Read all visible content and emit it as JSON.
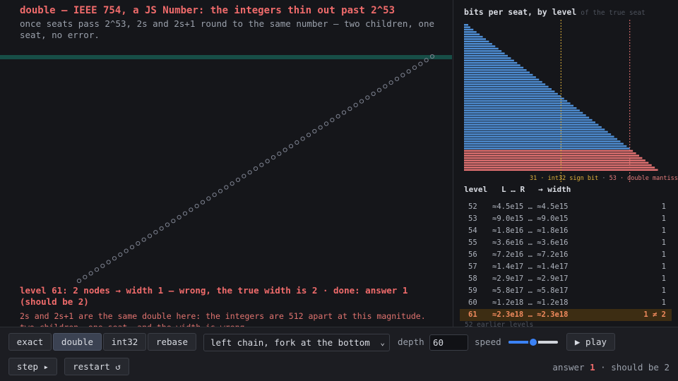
{
  "visualization": {
    "title": "double — IEEE 754, a JS Number: the integers thin out past 2^53",
    "subtitle": "once seats pass 2^53, 2s and 2s+1 round to the same number — two children, one seat, no error.",
    "status": "level 61: 2 nodes → width 1 — wrong, the true width is 2 · done: answer 1 (should be 2)",
    "explanation": "2s and 2s+1 are the same double here: the integers are 512 apart at this magnitude. two children, one seat, and the width is wrong."
  },
  "bits_panel": {
    "title": "bits per seat, by level",
    "subtitle": "of the true seat",
    "marker_int32": "31 · int32 sign bit",
    "marker_separator": " · ",
    "marker_double": "53 · double mantissa",
    "colors": {
      "exact": "#4f8fd6",
      "lossy": "#e57373",
      "int32_marker": "#e0b23c",
      "double_marker": "#e57373"
    }
  },
  "table": {
    "headers": {
      "level": "level",
      "range": "L … R",
      "width": "→ width"
    },
    "rows": [
      {
        "level": "52",
        "range": "≈4.5e15 … ≈4.5e15",
        "width": "1",
        "highlight": false
      },
      {
        "level": "53",
        "range": "≈9.0e15 … ≈9.0e15",
        "width": "1",
        "highlight": false
      },
      {
        "level": "54",
        "range": "≈1.8e16 … ≈1.8e16",
        "width": "1",
        "highlight": false
      },
      {
        "level": "55",
        "range": "≈3.6e16 … ≈3.6e16",
        "width": "1",
        "highlight": false
      },
      {
        "level": "56",
        "range": "≈7.2e16 … ≈7.2e16",
        "width": "1",
        "highlight": false
      },
      {
        "level": "57",
        "range": "≈1.4e17 … ≈1.4e17",
        "width": "1",
        "highlight": false
      },
      {
        "level": "58",
        "range": "≈2.9e17 … ≈2.9e17",
        "width": "1",
        "highlight": false
      },
      {
        "level": "59",
        "range": "≈5.8e17 … ≈5.8e17",
        "width": "1",
        "highlight": false
      },
      {
        "level": "60",
        "range": "≈1.2e18 … ≈1.2e18",
        "width": "1",
        "highlight": false
      },
      {
        "level": "61",
        "range": "≈2.3e18 … ≈2.3e18",
        "width": "1 ≠ 2",
        "highlight": true
      }
    ],
    "more": "52 earlier levels"
  },
  "controls": {
    "modes": [
      "exact",
      "double",
      "int32",
      "rebase"
    ],
    "active_mode": "double",
    "tree_shape": "left chain, fork at the bottom",
    "depth_label": "depth",
    "depth_value": "60",
    "speed_label": "speed",
    "speed_fraction": 0.5,
    "play_label": "▶ play",
    "step_label": "step ▸",
    "restart_label": "restart ↺",
    "answer_label": "answer",
    "answer_value": "1",
    "answer_separator": "·",
    "should_be": "should be 2"
  }
}
